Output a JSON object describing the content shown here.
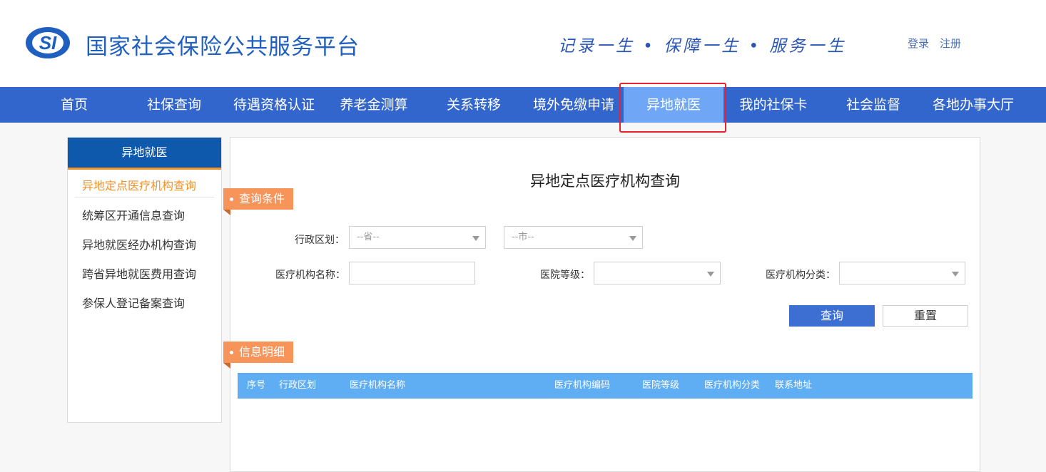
{
  "header": {
    "logo_text": "SI",
    "site_title": "国家社会保险公共服务平台",
    "slogan": "记录一生 • 保障一生 • 服务一生",
    "login": "登录",
    "register": "注册"
  },
  "nav": {
    "items": [
      {
        "label": "首页"
      },
      {
        "label": "社保查询"
      },
      {
        "label": "待遇资格认证"
      },
      {
        "label": "养老金测算"
      },
      {
        "label": "关系转移"
      },
      {
        "label": "境外免缴申请"
      },
      {
        "label": "异地就医"
      },
      {
        "label": "我的社保卡"
      },
      {
        "label": "社会监督"
      },
      {
        "label": "各地办事大厅"
      }
    ],
    "active_index": 6
  },
  "sidebar": {
    "title": "异地就医",
    "items": [
      {
        "label": "异地定点医疗机构查询",
        "active": true
      },
      {
        "label": "统筹区开通信息查询"
      },
      {
        "label": "异地就医经办机构查询"
      },
      {
        "label": "跨省异地就医费用查询"
      },
      {
        "label": "参保人登记备案查询"
      }
    ]
  },
  "main": {
    "title": "异地定点医疗机构查询",
    "query_section": "查询条件",
    "detail_section": "信息明细",
    "form": {
      "region_label": "行政区划：",
      "province_placeholder": "--省--",
      "city_placeholder": "--市--",
      "name_label": "医疗机构名称：",
      "name_value": "",
      "level_label": "医院等级：",
      "level_value": "",
      "category_label": "医疗机构分类：",
      "category_value": ""
    },
    "buttons": {
      "search": "查询",
      "reset": "重置"
    },
    "table": {
      "columns": [
        "序号",
        "行政区划",
        "医疗机构名称",
        "医疗机构编码",
        "医院等级",
        "医疗机构分类",
        "联系地址"
      ],
      "rows": []
    }
  },
  "colors": {
    "nav_bg": "#3366cc",
    "nav_active": "#6fa6f5",
    "highlight": "#e8232d",
    "accent_orange": "#f7945a",
    "table_header": "#5fadf2",
    "primary_button": "#3d6fd3"
  }
}
